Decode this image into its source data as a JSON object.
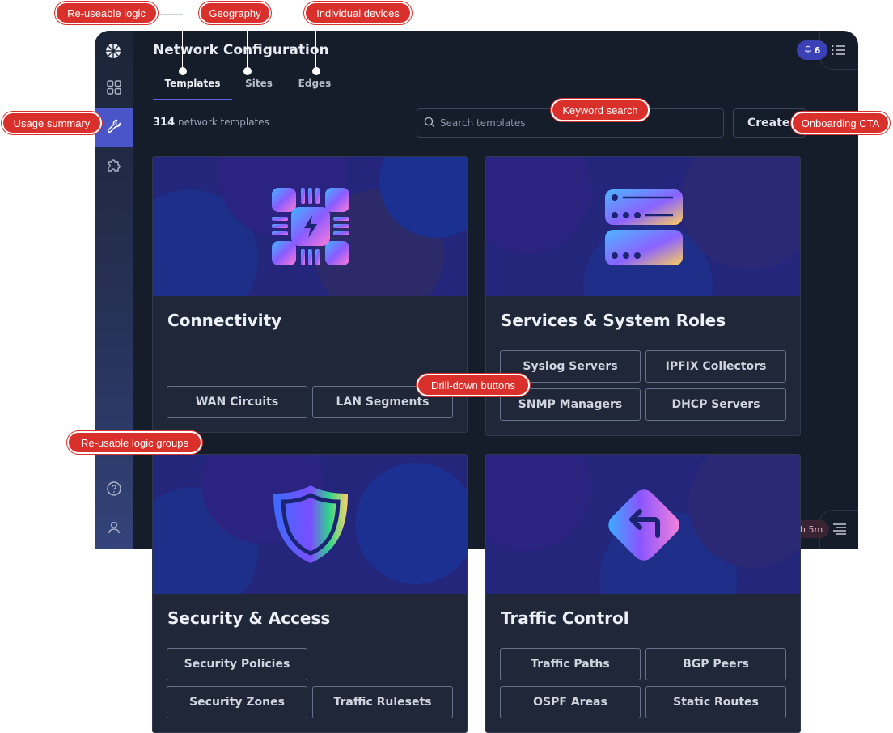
{
  "app": {
    "title": "Network Configuration",
    "tabs": [
      {
        "label": "Templates"
      },
      {
        "label": "Sites"
      },
      {
        "label": "Edges"
      }
    ],
    "notification_count": "6",
    "template_count": "314",
    "template_count_suffix": "network templates",
    "search_placeholder": "Search templates",
    "create_label": "Create",
    "timer": "1h 5m"
  },
  "cards": [
    {
      "title": "Connectivity",
      "buttons": [
        "WAN Circuits",
        "LAN Segments"
      ]
    },
    {
      "title": "Services & System Roles",
      "buttons": [
        "Syslog Servers",
        "IPFIX Collectors",
        "SNMP Managers",
        "DHCP Servers"
      ]
    },
    {
      "title": "Security & Access",
      "buttons": [
        "Security Policies",
        "Security Zones",
        "Traffic Rulesets"
      ]
    },
    {
      "title": "Traffic Control",
      "buttons": [
        "Traffic Paths",
        "BGP Peers",
        "OSPF Areas",
        "Static Routes"
      ]
    }
  ],
  "annotations": {
    "reuseable_logic": "Re-useable logic",
    "geography": "Geography",
    "individual_devices": "Individual devices",
    "usage_summary": "Usage summary",
    "keyword_search": "Keyword search",
    "onboarding_cta": "Onboarding CTA",
    "drill_down": "Drill-down buttons",
    "logic_groups": "Re-usable logic groups"
  },
  "colors": {
    "app_bg": "#151c2a",
    "accent": "#5b64e0",
    "annotation": "#d9302c",
    "card_bg": "#1f2738"
  },
  "icons": [
    "logo-icon",
    "grid-icon",
    "wrench-icon",
    "puzzle-icon",
    "help-icon",
    "user-icon",
    "bell-icon",
    "list-icon",
    "search-icon",
    "timer-icon",
    "menu-icon",
    "chip-icon",
    "server-icon",
    "shield-icon",
    "route-sign-icon"
  ]
}
